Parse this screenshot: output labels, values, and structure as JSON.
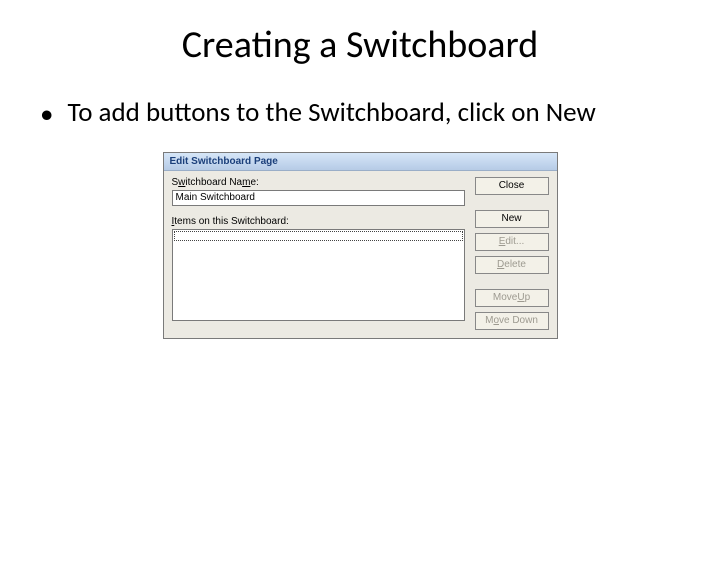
{
  "slide": {
    "title": "Creating a Switchboard",
    "bullet": "To add buttons to the Switchboard, click on New"
  },
  "dialog": {
    "title": "Edit Switchboard Page",
    "name_label": "Switchboard Name:",
    "name_value": "Main Switchboard",
    "items_label": "Items on this Switchboard:",
    "buttons": {
      "close": "Close",
      "new": "New",
      "edit": "Edit...",
      "delete": "Delete",
      "move_up": "Move Up",
      "move_down": "Move Down"
    }
  }
}
